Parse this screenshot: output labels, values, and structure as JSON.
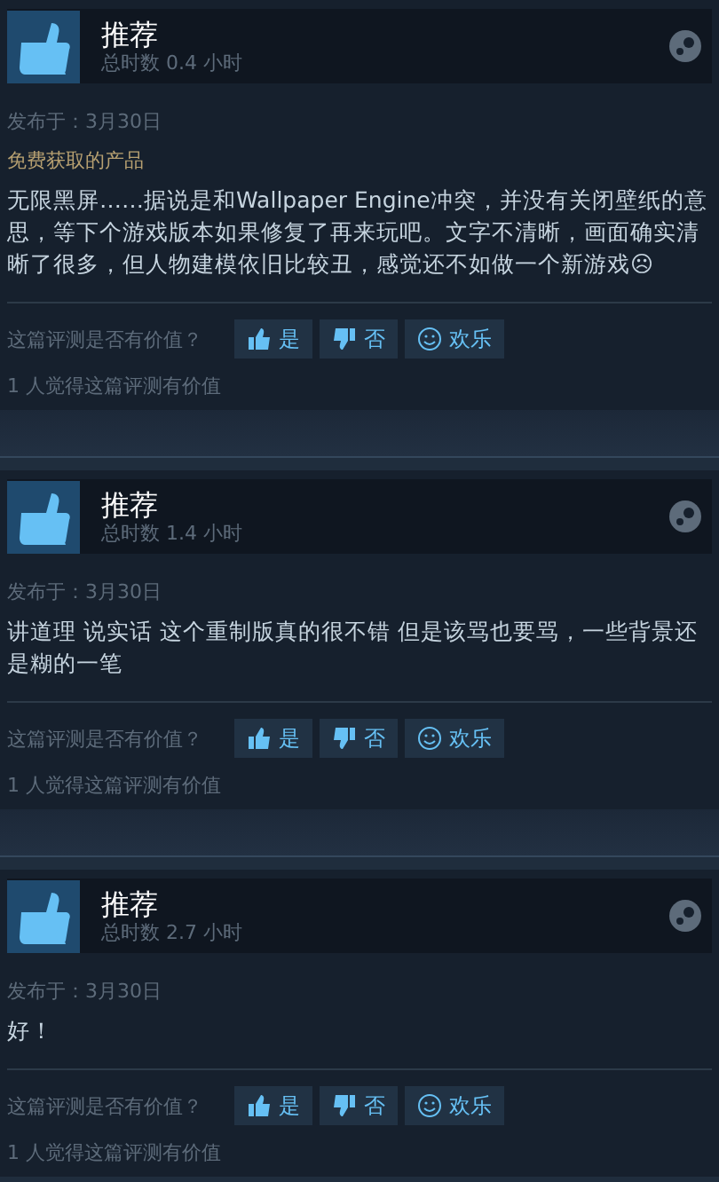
{
  "reviews": [
    {
      "verdict": "推荐",
      "hours": "总时数 0.4 小时",
      "posted": "发布于：3月30日",
      "tag": "免费获取的产品",
      "body": "无限黑屏……据说是和Wallpaper Engine冲突，并没有关闭壁纸的意思，等下个游戏版本如果修复了再来玩吧。文字不清晰，画面确实清晰了很多，但人物建模依旧比较丑，感觉还不如做一个新游戏☹",
      "helpful_prompt": "这篇评测是否有价值？",
      "votes": [
        {
          "kind": "yes",
          "label": "是"
        },
        {
          "kind": "no",
          "label": "否"
        },
        {
          "kind": "funny",
          "label": "欢乐"
        }
      ],
      "helpful_count": "1 人觉得这篇评测有价值"
    },
    {
      "verdict": "推荐",
      "hours": "总时数 1.4 小时",
      "posted": "发布于：3月30日",
      "body": "讲道理 说实话 这个重制版真的很不错 但是该骂也要骂，一些背景还是糊的一笔",
      "helpful_prompt": "这篇评测是否有价值？",
      "votes": [
        {
          "kind": "yes",
          "label": "是"
        },
        {
          "kind": "no",
          "label": "否"
        },
        {
          "kind": "funny",
          "label": "欢乐"
        }
      ],
      "helpful_count": "1 人觉得这篇评测有价值"
    },
    {
      "verdict": "推荐",
      "hours": "总时数 2.7 小时",
      "posted": "发布于：3月30日",
      "body": "好！",
      "helpful_prompt": "这篇评测是否有价值？",
      "votes": [
        {
          "kind": "yes",
          "label": "是"
        },
        {
          "kind": "no",
          "label": "否"
        },
        {
          "kind": "funny",
          "label": "欢乐"
        }
      ],
      "helpful_count": "1 人觉得这篇评测有价值"
    }
  ]
}
